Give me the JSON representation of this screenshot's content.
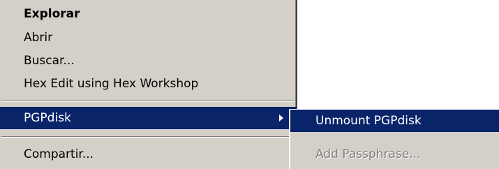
{
  "context_menu": {
    "items": [
      {
        "label": "Explorar"
      },
      {
        "label": "Abrir"
      },
      {
        "label": "Buscar..."
      },
      {
        "label": "Hex Edit using Hex Workshop"
      },
      {
        "label": "PGPdisk"
      },
      {
        "label": "Compartir..."
      }
    ],
    "selected_item": "PGPdisk",
    "submenu_arrow_icon": "triangle-right-icon"
  },
  "submenu": {
    "items": [
      {
        "label": "Unmount PGPdisk",
        "state": "selected"
      },
      {
        "label": "Add Passphrase...",
        "state": "disabled"
      }
    ]
  },
  "colors": {
    "menu_bg": "#d4d0c8",
    "selection_bg": "#0a246a",
    "selection_text": "#ffffff",
    "disabled_text": "#808080"
  }
}
